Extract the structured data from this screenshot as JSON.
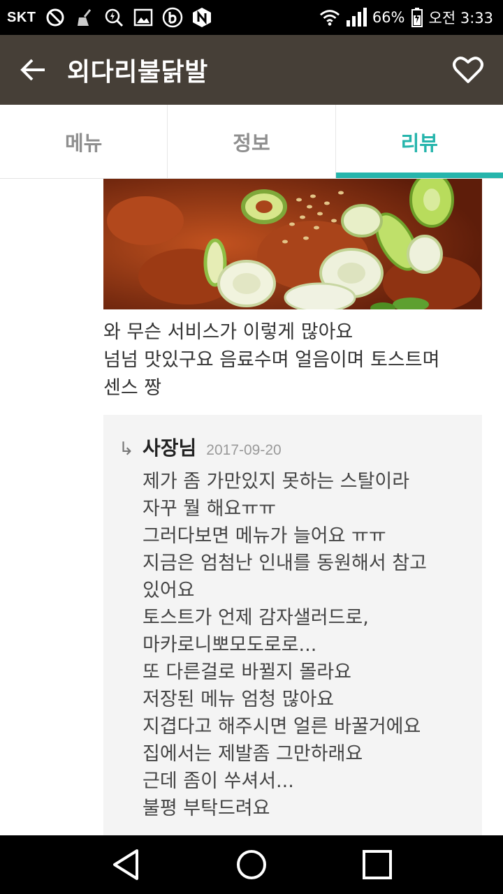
{
  "status_bar": {
    "carrier": "SKT",
    "battery": "66%",
    "time": "오전 3:33",
    "icons": [
      "no-disturb-icon",
      "broom-icon",
      "search-boost-icon",
      "image-icon",
      "b-app-icon",
      "n-app-icon",
      "wifi-icon",
      "signal-icon",
      "battery-icon"
    ]
  },
  "app_bar": {
    "title": "외다리불닭발",
    "back_icon": "back-arrow-icon",
    "favorite_icon": "heart-outline-icon"
  },
  "tabs": [
    {
      "label": "메뉴",
      "active": false
    },
    {
      "label": "정보",
      "active": false
    },
    {
      "label": "리뷰",
      "active": true
    }
  ],
  "review": {
    "lines": [
      "와 무슨 서비스가 이렇게 많아요",
      "넘넘 맛있구요 음료수며 얼음이며 토스트며",
      "센스 짱"
    ]
  },
  "reply": {
    "author": "사장님",
    "date": "2017-09-20",
    "lines": [
      "제가 좀 가만있지 못하는 스탈이라",
      "자꾸 뭘 해요ㅠㅠ",
      "그러다보면 메뉴가 늘어요 ㅠㅠ",
      "지금은 엄첨난 인내를 동원해서 참고",
      "있어요",
      "토스트가 언제 감자샐러드로,",
      "마카로니뽀모도로로...",
      "또 다른걸로 바뀔지 몰라요",
      "저장된 메뉴 엄청 많아요",
      "지겹다고 해주시면 얼른 바꿀거에요",
      "집에서는 제발좀 그만하래요",
      "근데 좀이 쑤셔서...",
      "불평 부탁드려요"
    ]
  },
  "colors": {
    "app_bar": "#463f37",
    "accent": "#26b5ac",
    "reply_bg": "#f4f4f4"
  }
}
